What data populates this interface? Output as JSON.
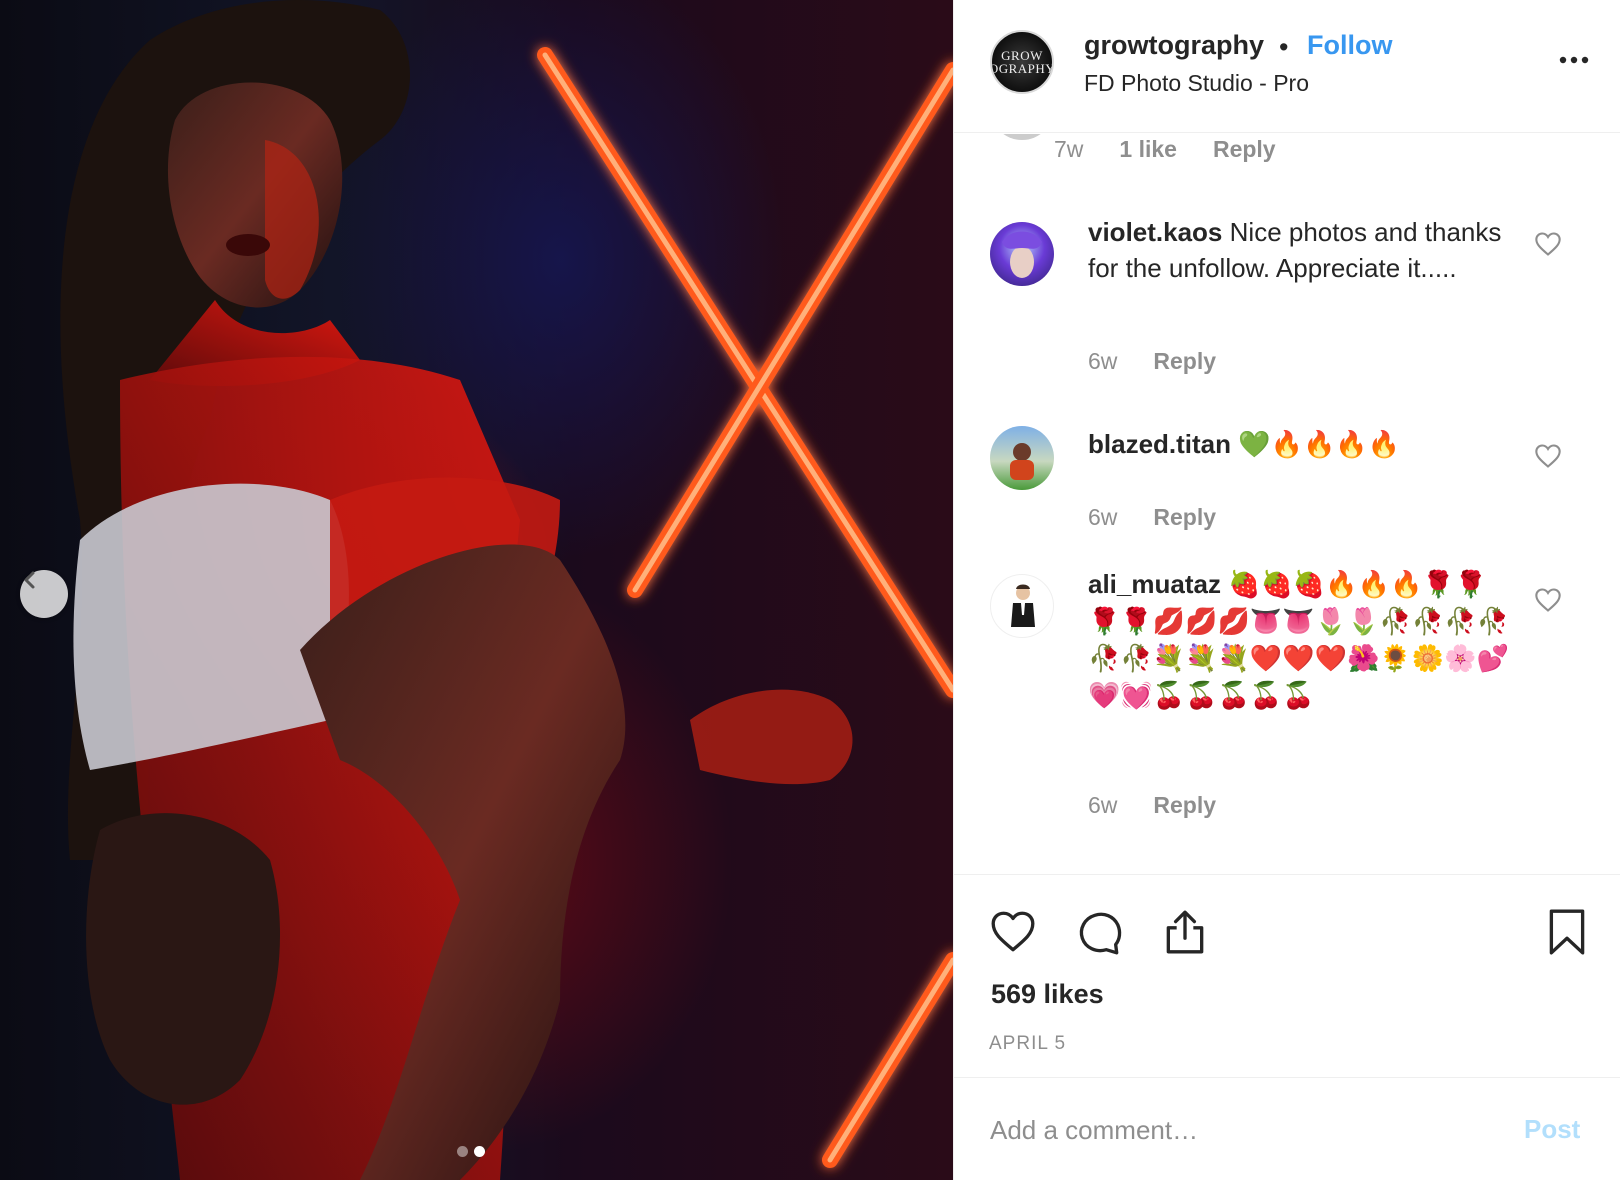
{
  "post": {
    "username": "growtography",
    "separator": "•",
    "follow_label": "Follow",
    "location": "FD Photo Studio - Pro",
    "logo_text_line1": "GROW",
    "logo_text_line2": "OGRAPHY",
    "more_icon": "more-horizontal-icon",
    "carousel": {
      "dots": 2,
      "active_index": 1,
      "prev_icon": "chevron-left-icon"
    }
  },
  "previous_comment_meta": {
    "time": "7w",
    "likes": "1 like",
    "reply": "Reply"
  },
  "comments": [
    {
      "username": "violet.kaos",
      "text": "Nice photos and thanks for the unfollow. Appreciate it.....",
      "time": "6w",
      "reply": "Reply"
    },
    {
      "username": "blazed.titan",
      "text": "💚🔥🔥🔥🔥",
      "time": "6w",
      "reply": "Reply"
    },
    {
      "username": "ali_muataz",
      "text": "🍓🍓🍓🔥🔥🔥🌹🌹🌹🌹💋💋💋👅👅🌷🌷🥀🥀🥀🥀🥀🥀💐💐💐❤️❤️❤️🌺🌻🌼🌸💕💗💓🍒🍒🍒🍒🍒",
      "time": "6w",
      "reply": "Reply"
    }
  ],
  "actions": {
    "like_icon": "heart-icon",
    "comment_icon": "comment-icon",
    "share_icon": "share-icon",
    "save_icon": "bookmark-icon"
  },
  "likes": "569 likes",
  "date": "APRIL 5",
  "comment_box": {
    "placeholder": "Add a comment…",
    "post_label": "Post"
  },
  "colors": {
    "accent": "#3897f0",
    "muted": "#8e8e8e",
    "post_disabled": "#b2dffc",
    "text": "#262626"
  }
}
